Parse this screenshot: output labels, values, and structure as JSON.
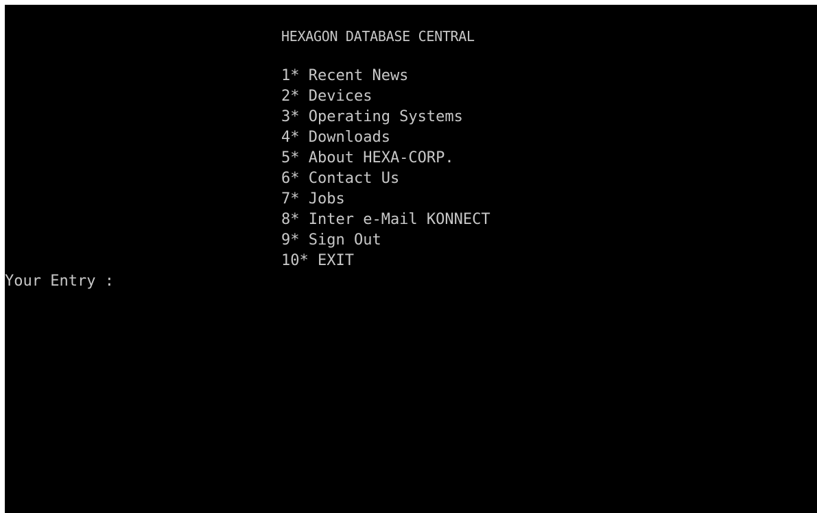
{
  "header": {
    "title": "HEXAGON DATABASE CENTRAL"
  },
  "menu": {
    "items": [
      {
        "label": "1* Recent News"
      },
      {
        "label": "2* Devices"
      },
      {
        "label": "3* Operating Systems"
      },
      {
        "label": "4* Downloads"
      },
      {
        "label": "5* About HEXA-CORP."
      },
      {
        "label": "6* Contact Us"
      },
      {
        "label": "7* Jobs"
      },
      {
        "label": "8* Inter e-Mail KONNECT"
      },
      {
        "label": "9* Sign Out"
      },
      {
        "label": "10* EXIT"
      }
    ]
  },
  "prompt": {
    "label": "Your Entry :",
    "value": ""
  },
  "colors": {
    "background": "#000000",
    "text": "#c8c8c8"
  }
}
